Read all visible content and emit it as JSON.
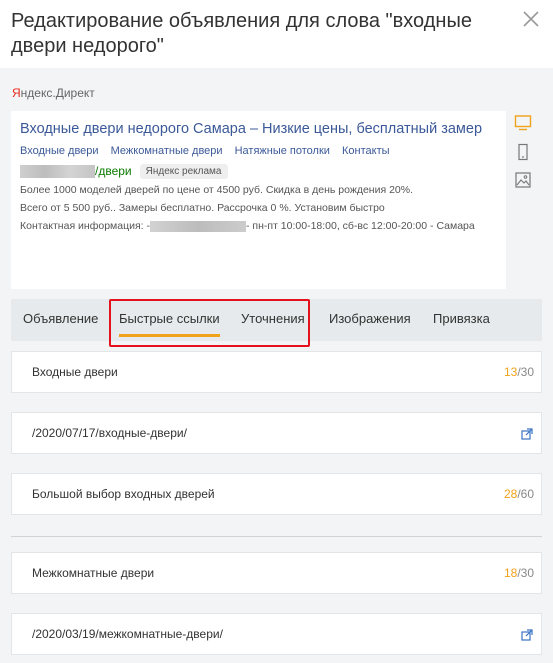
{
  "header": {
    "title": "Редактирование объявления для слова \"входные двери недорого\""
  },
  "brand": {
    "y_letter": "Я",
    "rest": "ндекс.Директ"
  },
  "ad_preview": {
    "title": "Входные двери недорого Самара – Низкие цены, бесплатный замер",
    "sitelinks": [
      "Входные двери",
      "Межкомнатные двери",
      "Натяжные потолки",
      "Контакты"
    ],
    "url_suffix": "/двери",
    "badge": "Яндекс реклама",
    "text_line1": "Более 1000 моделей дверей по цене от 4500 руб. Скидка в день рождения 20%.",
    "text_line2": "Всего от 5 500 руб.. Замеры бесплатно. Рассрочка 0 %. Установим быстро",
    "contact_prefix": "Контактная информация: -",
    "contact_suffix": "- пн-пт 10:00-18:00, сб-вс 12:00-20:00 - Самара"
  },
  "side_icons": [
    "desktop-icon",
    "mobile-icon",
    "image-icon"
  ],
  "tabs": [
    {
      "label": "Объявление",
      "active": false
    },
    {
      "label": "Быстрые ссылки",
      "active": true
    },
    {
      "label": "Уточнения",
      "active": false
    },
    {
      "label": "Изображения",
      "active": false
    },
    {
      "label": "Привязка",
      "active": false
    }
  ],
  "quick_links": {
    "link1": {
      "title": "Входные двери",
      "title_count": "13",
      "title_max": "/30",
      "url": "/2020/07/17/входные-двери/",
      "desc": "Большой выбор входных дверей",
      "desc_count": "28",
      "desc_max": "/60"
    },
    "link2": {
      "title": "Межкомнатные двери",
      "title_count": "18",
      "title_max": "/30",
      "url": "/2020/03/19/межкомнатные-двери/"
    }
  },
  "colors": {
    "accent": "#f0a21b",
    "link": "#3b5998",
    "url_green": "#0a7a00",
    "highlight": "#e3121c"
  }
}
